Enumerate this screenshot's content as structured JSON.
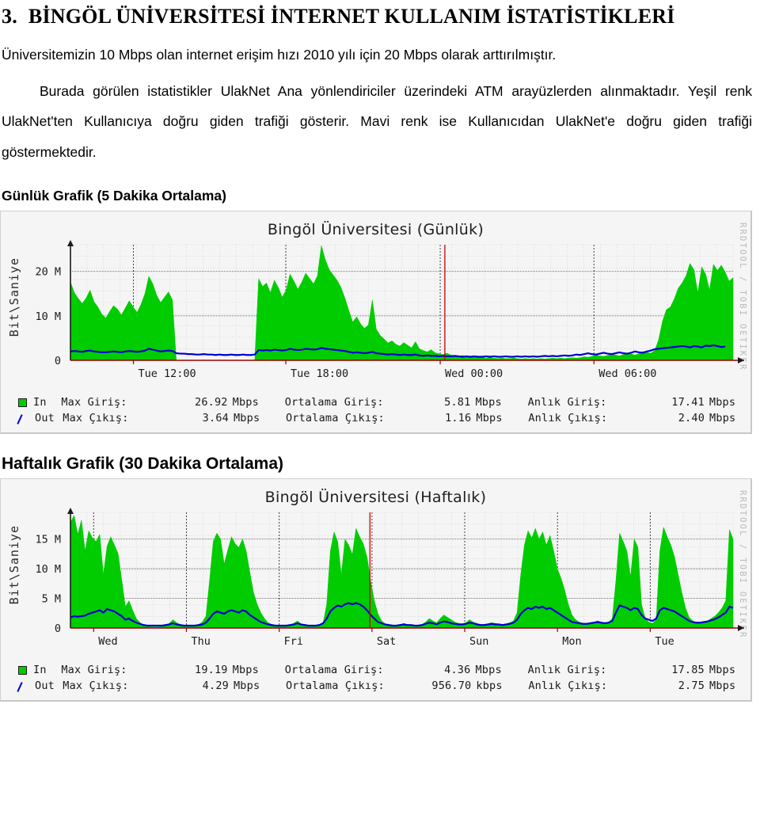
{
  "document": {
    "section_number": "3.",
    "title": "BİNGÖL ÜNİVERSİTESİ İNTERNET KULLANIM İSTATİSTİKLERİ",
    "intro": "Üniversitemizin 10 Mbps olan internet erişim hızı 2010 yılı için 20 Mbps olarak arttırılmıştır.",
    "paragraph": "Burada görülen istatistikler UlakNet Ana yönlendiriciler üzerindeki ATM arayüzlerden alınmaktadır. Yeşil renk UlakNet'ten Kullanıcıya doğru giden trafiği gösterir. Mavi renk ise Kullanıcıdan UlakNet'e doğru giden trafiği göstermektedir."
  },
  "colors": {
    "in_green": "#00cc00",
    "out_blue": "#0000cc",
    "axis_red": "#990000",
    "panel_bg": "#f5f5f5",
    "grid_gray": "#808080"
  },
  "sections": [
    {
      "heading": "Günlük Grafik (5 Dakika Ortalama)",
      "graph": {
        "title": "Bingöl Üniversitesi (Günlük)",
        "ylabel": "Bit\\Saniye",
        "watermark": "RRDTOOL / TOBI OETIKER",
        "stats": {
          "in_label": "In",
          "out_label": "Out",
          "max_in_label": "Max Giriş:",
          "max_in_value": "26.92",
          "max_in_unit": "Mbps",
          "max_out_label": "Max Çıkış:",
          "max_out_value": "3.64",
          "max_out_unit": "Mbps",
          "avg_in_label": "Ortalama Giriş:",
          "avg_in_value": "5.81",
          "avg_in_unit": "Mbps",
          "avg_out_label": "Ortalama Çıkış:",
          "avg_out_value": "1.16",
          "avg_out_unit": "Mbps",
          "cur_in_label": "Anlık Giriş:",
          "cur_in_value": "17.41",
          "cur_in_unit": "Mbps",
          "cur_out_label": "Anlık Çıkış:",
          "cur_out_value": "2.40",
          "cur_out_unit": "Mbps"
        }
      }
    },
    {
      "heading": "Haftalık Grafik (30 Dakika Ortalama)",
      "graph": {
        "title": "Bingöl Üniversitesi (Haftalık)",
        "ylabel": "Bit\\Saniye",
        "watermark": "RRDTOOL / TOBI OETIKER",
        "stats": {
          "in_label": "In",
          "out_label": "Out",
          "max_in_label": "Max Giriş:",
          "max_in_value": "19.19",
          "max_in_unit": "Mbps",
          "max_out_label": "Max Çıkış:",
          "max_out_value": "4.29",
          "max_out_unit": "Mbps",
          "avg_in_label": "Ortalama Giriş:",
          "avg_in_value": "4.36",
          "avg_in_unit": "Mbps",
          "avg_out_label": "Ortalama Çıkış:",
          "avg_out_value": "956.70",
          "avg_out_unit": "kbps",
          "cur_in_label": "Anlık Giriş:",
          "cur_in_value": "17.85",
          "cur_in_unit": "Mbps",
          "cur_out_label": "Anlık Çıkış:",
          "cur_out_value": "2.75",
          "cur_out_unit": "Mbps"
        }
      }
    }
  ],
  "chart_data": [
    {
      "type": "area",
      "title": "Bingöl Üniversitesi (Günlük)",
      "xlabel": "",
      "ylabel": "Bit\\Saniye",
      "yticks": [
        "0",
        "10 M",
        "20 M"
      ],
      "ytick_values": [
        0,
        10000000,
        20000000
      ],
      "ylim": [
        0,
        26000000
      ],
      "xticks": [
        "Tue 12:00",
        "Tue 18:00",
        "Wed 00:00",
        "Wed 06:00"
      ],
      "xtick_positions": [
        0.095,
        0.325,
        0.558,
        0.79
      ],
      "grid": true,
      "legend": [
        "In",
        "Out"
      ],
      "legend_position": "below",
      "now_marker_position": 0.565,
      "series": [
        {
          "name": "In",
          "color": "#00cc00",
          "values": [
            17.6,
            15.2,
            13.9,
            12.8,
            14.0,
            15.8,
            13.2,
            12.0,
            10.4,
            9.5,
            11.0,
            12.3,
            11.5,
            10.2,
            11.8,
            13.4,
            12.0,
            10.8,
            12.6,
            15.0,
            18.9,
            17.2,
            14.6,
            13.0,
            14.2,
            15.4,
            13.6,
            0,
            0,
            0,
            0,
            0,
            0,
            0,
            0,
            0,
            0,
            0,
            0,
            0,
            0,
            0,
            0,
            0,
            0,
            0,
            0,
            0,
            18.4,
            16.6,
            17.4,
            15.2,
            18.0,
            16.4,
            14.2,
            15.8,
            19.4,
            17.8,
            16.0,
            17.6,
            19.6,
            18.4,
            17.2,
            19.0,
            25.8,
            22.6,
            20.4,
            19.2,
            18.0,
            16.4,
            14.0,
            11.2,
            8.6,
            9.8,
            8.2,
            7.2,
            8.0,
            13.6,
            7.0,
            5.6,
            4.8,
            3.9,
            4.4,
            3.6,
            3.2,
            4.0,
            3.4,
            2.8,
            4.2,
            2.6,
            2.2,
            1.9,
            2.4,
            1.7,
            1.5,
            1.3,
            1.6,
            1.2,
            1.0,
            0.9,
            1.1,
            0.8,
            0.7,
            0.9,
            0.6,
            0.7,
            0.5,
            0.6,
            0.5,
            0.4,
            0.5,
            0.4,
            0.4,
            0.5,
            0.4,
            0.3,
            0.4,
            0.3,
            0.4,
            0.3,
            0.4,
            0.3,
            0.4,
            0.5,
            0.4,
            0.5,
            0.4,
            0.5,
            0.6,
            0.5,
            0.6,
            0.8,
            0.7,
            0.9,
            1.2,
            1.0,
            0.9,
            1.1,
            1.4,
            1.2,
            1.0,
            1.3,
            1.6,
            1.4,
            1.2,
            1.5,
            2.0,
            1.8,
            1.6,
            2.2,
            4.6,
            8.8,
            11.4,
            12.0,
            13.8,
            16.2,
            17.4,
            19.0,
            21.8,
            20.4,
            15.2,
            21.0,
            19.4,
            15.8,
            21.6,
            20.2,
            21.4,
            19.8,
            17.8,
            18.6
          ]
        },
        {
          "name": "Out",
          "color": "#0000cc",
          "values": [
            2.0,
            2.1,
            2.0,
            1.9,
            2.1,
            2.2,
            2.0,
            1.9,
            1.8,
            1.8,
            1.9,
            2.0,
            1.9,
            1.8,
            2.0,
            2.1,
            2.0,
            1.9,
            2.0,
            2.2,
            2.6,
            2.4,
            2.2,
            2.0,
            2.1,
            2.2,
            2.1,
            1.6,
            1.5,
            1.5,
            1.4,
            1.4,
            1.3,
            1.3,
            1.4,
            1.3,
            1.3,
            1.2,
            1.3,
            1.2,
            1.2,
            1.3,
            1.2,
            1.2,
            1.3,
            1.2,
            1.2,
            1.3,
            2.3,
            2.2,
            2.3,
            2.2,
            2.4,
            2.3,
            2.2,
            2.3,
            2.6,
            2.4,
            2.3,
            2.4,
            2.6,
            2.5,
            2.4,
            2.5,
            2.8,
            2.6,
            2.5,
            2.4,
            2.3,
            2.2,
            2.1,
            1.9,
            1.7,
            1.8,
            1.7,
            1.6,
            1.7,
            1.9,
            1.6,
            1.5,
            1.4,
            1.3,
            1.4,
            1.3,
            1.2,
            1.3,
            1.2,
            1.2,
            1.3,
            1.1,
            1.0,
            1.1,
            1.0,
            1.0,
            0.9,
            1.0,
            0.9,
            0.9,
            1.0,
            0.9,
            0.8,
            0.9,
            0.8,
            0.9,
            0.8,
            0.8,
            0.9,
            0.8,
            0.9,
            0.8,
            0.8,
            0.9,
            0.8,
            0.8,
            0.9,
            0.8,
            0.9,
            0.8,
            0.9,
            0.8,
            0.9,
            1.0,
            0.9,
            1.0,
            0.9,
            1.0,
            1.1,
            1.0,
            1.1,
            1.3,
            1.2,
            1.4,
            1.6,
            1.4,
            1.3,
            1.5,
            1.7,
            1.5,
            1.4,
            1.6,
            1.8,
            1.6,
            1.5,
            1.7,
            2.0,
            1.8,
            1.7,
            2.0,
            2.2,
            2.5,
            2.6,
            2.7,
            2.8,
            2.9,
            3.0,
            3.1,
            3.2,
            3.1,
            2.9,
            3.2,
            3.1,
            2.9,
            3.3,
            3.2,
            3.4,
            3.2,
            3.0,
            3.1
          ]
        }
      ]
    },
    {
      "type": "area",
      "title": "Bingöl Üniversitesi (Haftalık)",
      "xlabel": "",
      "ylabel": "Bit\\Saniye",
      "yticks": [
        "0",
        "5 M",
        "10 M",
        "15 M"
      ],
      "ytick_values": [
        0,
        5000000,
        10000000,
        15000000
      ],
      "ylim": [
        0,
        19500000
      ],
      "xticks": [
        "Wed",
        "Thu",
        "Fri",
        "Sat",
        "Sun",
        "Mon",
        "Tue"
      ],
      "xtick_positions": [
        0.035,
        0.175,
        0.315,
        0.455,
        0.595,
        0.735,
        0.875
      ],
      "grid": true,
      "legend": [
        "In",
        "Out"
      ],
      "legend_position": "below",
      "now_marker_position": 0.452,
      "series": [
        {
          "name": "In",
          "color": "#00cc00",
          "values": [
            17.8,
            19.0,
            15.8,
            18.2,
            13.0,
            16.4,
            15.2,
            14.6,
            15.8,
            9.0,
            13.8,
            15.4,
            14.0,
            12.6,
            8.2,
            3.6,
            4.6,
            3.0,
            1.6,
            0.9,
            0.5,
            0.3,
            0.2,
            0.2,
            0.2,
            0.3,
            0.5,
            0.8,
            1.4,
            0.9,
            0.6,
            0.4,
            0.3,
            0.3,
            0.4,
            0.6,
            1.0,
            2.0,
            8.0,
            14.6,
            16.0,
            15.0,
            10.8,
            13.2,
            15.4,
            14.2,
            13.6,
            15.0,
            13.0,
            9.4,
            6.0,
            4.0,
            2.6,
            1.6,
            0.9,
            0.6,
            0.4,
            0.3,
            0.3,
            0.4,
            0.5,
            0.8,
            1.2,
            0.7,
            0.5,
            0.4,
            0.3,
            0.3,
            0.4,
            0.8,
            4.0,
            13.0,
            16.2,
            14.6,
            9.0,
            15.0,
            14.0,
            12.4,
            16.8,
            15.4,
            14.2,
            12.0,
            8.0,
            4.6,
            2.4,
            1.2,
            0.7,
            0.5,
            0.4,
            0.4,
            0.5,
            0.8,
            0.6,
            0.5,
            0.4,
            0.4,
            0.6,
            1.0,
            1.6,
            1.2,
            0.9,
            1.6,
            2.2,
            1.8,
            1.4,
            1.0,
            0.8,
            0.7,
            0.9,
            1.4,
            1.0,
            0.8,
            0.6,
            0.6,
            0.7,
            0.9,
            0.8,
            0.7,
            0.6,
            0.7,
            0.9,
            1.2,
            2.6,
            9.0,
            14.0,
            16.4,
            15.2,
            16.8,
            15.0,
            16.2,
            14.0,
            15.6,
            13.0,
            10.0,
            8.4,
            6.4,
            4.0,
            2.2,
            1.4,
            1.0,
            0.8,
            0.7,
            0.8,
            1.0,
            1.2,
            1.0,
            0.8,
            1.0,
            1.6,
            8.0,
            16.0,
            14.6,
            13.0,
            8.6,
            15.0,
            13.6,
            4.0,
            1.6,
            1.0,
            0.8,
            1.4,
            13.0,
            17.0,
            15.4,
            14.0,
            12.0,
            9.0,
            6.0,
            3.4,
            1.8,
            1.2,
            0.9,
            0.8,
            1.0,
            1.2,
            1.6,
            2.0,
            2.6,
            3.4,
            4.6,
            16.6,
            15.0
          ]
        },
        {
          "name": "Out",
          "color": "#0000cc",
          "values": [
            1.8,
            2.0,
            1.9,
            2.0,
            2.1,
            2.4,
            2.6,
            2.8,
            3.0,
            2.6,
            3.2,
            3.0,
            2.8,
            2.4,
            2.0,
            1.4,
            1.6,
            1.2,
            0.9,
            0.7,
            0.5,
            0.4,
            0.4,
            0.4,
            0.4,
            0.4,
            0.5,
            0.6,
            0.8,
            0.6,
            0.5,
            0.4,
            0.4,
            0.4,
            0.4,
            0.5,
            0.6,
            0.9,
            1.6,
            2.4,
            2.8,
            2.6,
            2.4,
            2.8,
            3.0,
            2.8,
            2.6,
            3.0,
            2.8,
            2.2,
            1.8,
            1.4,
            1.0,
            0.8,
            0.6,
            0.5,
            0.4,
            0.4,
            0.4,
            0.4,
            0.5,
            0.6,
            0.8,
            0.6,
            0.5,
            0.4,
            0.4,
            0.4,
            0.5,
            0.8,
            1.6,
            2.8,
            3.4,
            3.8,
            3.6,
            4.0,
            4.2,
            4.0,
            4.2,
            4.0,
            3.6,
            3.0,
            2.2,
            1.6,
            1.0,
            0.8,
            0.6,
            0.5,
            0.4,
            0.4,
            0.5,
            0.6,
            0.5,
            0.5,
            0.4,
            0.4,
            0.5,
            0.7,
            0.9,
            0.8,
            0.6,
            0.9,
            1.1,
            1.0,
            0.8,
            0.7,
            0.6,
            0.6,
            0.7,
            0.9,
            0.8,
            0.6,
            0.5,
            0.5,
            0.6,
            0.7,
            0.6,
            0.6,
            0.5,
            0.6,
            0.7,
            0.9,
            1.4,
            2.4,
            3.0,
            3.4,
            3.2,
            3.6,
            3.4,
            3.6,
            3.2,
            3.4,
            3.0,
            2.6,
            2.2,
            1.8,
            1.4,
            1.0,
            0.9,
            0.8,
            0.7,
            0.7,
            0.8,
            0.9,
            1.0,
            0.9,
            0.8,
            0.9,
            1.2,
            2.6,
            3.8,
            3.6,
            3.4,
            3.0,
            3.4,
            3.2,
            2.2,
            1.6,
            1.4,
            1.2,
            1.6,
            3.0,
            3.4,
            3.2,
            3.0,
            2.8,
            2.4,
            2.0,
            1.6,
            1.2,
            1.0,
            0.9,
            0.9,
            1.0,
            1.1,
            1.3,
            1.5,
            1.8,
            2.2,
            2.6,
            3.6,
            3.4
          ]
        }
      ]
    }
  ]
}
